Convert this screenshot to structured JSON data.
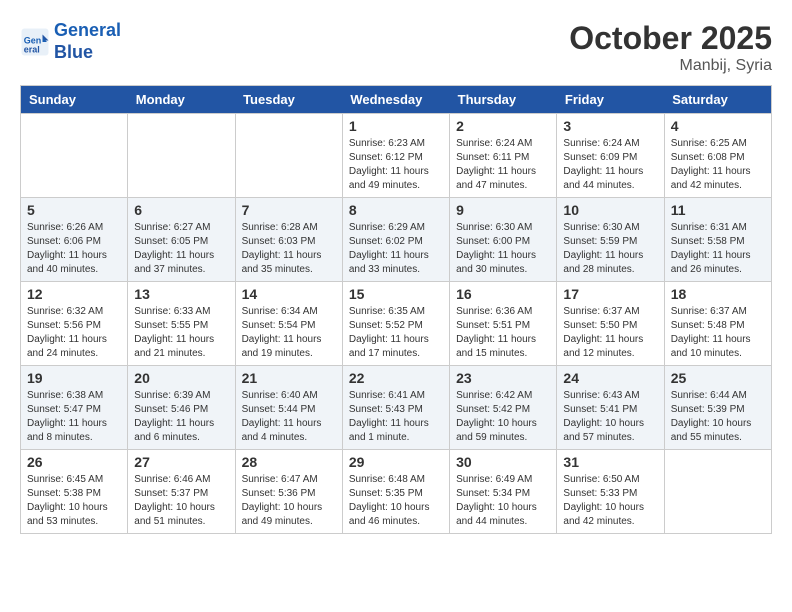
{
  "header": {
    "logo_line1": "General",
    "logo_line2": "Blue",
    "month": "October 2025",
    "location": "Manbij, Syria"
  },
  "days_of_week": [
    "Sunday",
    "Monday",
    "Tuesday",
    "Wednesday",
    "Thursday",
    "Friday",
    "Saturday"
  ],
  "weeks": [
    [
      {
        "day": "",
        "info": ""
      },
      {
        "day": "",
        "info": ""
      },
      {
        "day": "",
        "info": ""
      },
      {
        "day": "1",
        "info": "Sunrise: 6:23 AM\nSunset: 6:12 PM\nDaylight: 11 hours and 49 minutes."
      },
      {
        "day": "2",
        "info": "Sunrise: 6:24 AM\nSunset: 6:11 PM\nDaylight: 11 hours and 47 minutes."
      },
      {
        "day": "3",
        "info": "Sunrise: 6:24 AM\nSunset: 6:09 PM\nDaylight: 11 hours and 44 minutes."
      },
      {
        "day": "4",
        "info": "Sunrise: 6:25 AM\nSunset: 6:08 PM\nDaylight: 11 hours and 42 minutes."
      }
    ],
    [
      {
        "day": "5",
        "info": "Sunrise: 6:26 AM\nSunset: 6:06 PM\nDaylight: 11 hours and 40 minutes."
      },
      {
        "day": "6",
        "info": "Sunrise: 6:27 AM\nSunset: 6:05 PM\nDaylight: 11 hours and 37 minutes."
      },
      {
        "day": "7",
        "info": "Sunrise: 6:28 AM\nSunset: 6:03 PM\nDaylight: 11 hours and 35 minutes."
      },
      {
        "day": "8",
        "info": "Sunrise: 6:29 AM\nSunset: 6:02 PM\nDaylight: 11 hours and 33 minutes."
      },
      {
        "day": "9",
        "info": "Sunrise: 6:30 AM\nSunset: 6:00 PM\nDaylight: 11 hours and 30 minutes."
      },
      {
        "day": "10",
        "info": "Sunrise: 6:30 AM\nSunset: 5:59 PM\nDaylight: 11 hours and 28 minutes."
      },
      {
        "day": "11",
        "info": "Sunrise: 6:31 AM\nSunset: 5:58 PM\nDaylight: 11 hours and 26 minutes."
      }
    ],
    [
      {
        "day": "12",
        "info": "Sunrise: 6:32 AM\nSunset: 5:56 PM\nDaylight: 11 hours and 24 minutes."
      },
      {
        "day": "13",
        "info": "Sunrise: 6:33 AM\nSunset: 5:55 PM\nDaylight: 11 hours and 21 minutes."
      },
      {
        "day": "14",
        "info": "Sunrise: 6:34 AM\nSunset: 5:54 PM\nDaylight: 11 hours and 19 minutes."
      },
      {
        "day": "15",
        "info": "Sunrise: 6:35 AM\nSunset: 5:52 PM\nDaylight: 11 hours and 17 minutes."
      },
      {
        "day": "16",
        "info": "Sunrise: 6:36 AM\nSunset: 5:51 PM\nDaylight: 11 hours and 15 minutes."
      },
      {
        "day": "17",
        "info": "Sunrise: 6:37 AM\nSunset: 5:50 PM\nDaylight: 11 hours and 12 minutes."
      },
      {
        "day": "18",
        "info": "Sunrise: 6:37 AM\nSunset: 5:48 PM\nDaylight: 11 hours and 10 minutes."
      }
    ],
    [
      {
        "day": "19",
        "info": "Sunrise: 6:38 AM\nSunset: 5:47 PM\nDaylight: 11 hours and 8 minutes."
      },
      {
        "day": "20",
        "info": "Sunrise: 6:39 AM\nSunset: 5:46 PM\nDaylight: 11 hours and 6 minutes."
      },
      {
        "day": "21",
        "info": "Sunrise: 6:40 AM\nSunset: 5:44 PM\nDaylight: 11 hours and 4 minutes."
      },
      {
        "day": "22",
        "info": "Sunrise: 6:41 AM\nSunset: 5:43 PM\nDaylight: 11 hours and 1 minute."
      },
      {
        "day": "23",
        "info": "Sunrise: 6:42 AM\nSunset: 5:42 PM\nDaylight: 10 hours and 59 minutes."
      },
      {
        "day": "24",
        "info": "Sunrise: 6:43 AM\nSunset: 5:41 PM\nDaylight: 10 hours and 57 minutes."
      },
      {
        "day": "25",
        "info": "Sunrise: 6:44 AM\nSunset: 5:39 PM\nDaylight: 10 hours and 55 minutes."
      }
    ],
    [
      {
        "day": "26",
        "info": "Sunrise: 6:45 AM\nSunset: 5:38 PM\nDaylight: 10 hours and 53 minutes."
      },
      {
        "day": "27",
        "info": "Sunrise: 6:46 AM\nSunset: 5:37 PM\nDaylight: 10 hours and 51 minutes."
      },
      {
        "day": "28",
        "info": "Sunrise: 6:47 AM\nSunset: 5:36 PM\nDaylight: 10 hours and 49 minutes."
      },
      {
        "day": "29",
        "info": "Sunrise: 6:48 AM\nSunset: 5:35 PM\nDaylight: 10 hours and 46 minutes."
      },
      {
        "day": "30",
        "info": "Sunrise: 6:49 AM\nSunset: 5:34 PM\nDaylight: 10 hours and 44 minutes."
      },
      {
        "day": "31",
        "info": "Sunrise: 6:50 AM\nSunset: 5:33 PM\nDaylight: 10 hours and 42 minutes."
      },
      {
        "day": "",
        "info": ""
      }
    ]
  ]
}
